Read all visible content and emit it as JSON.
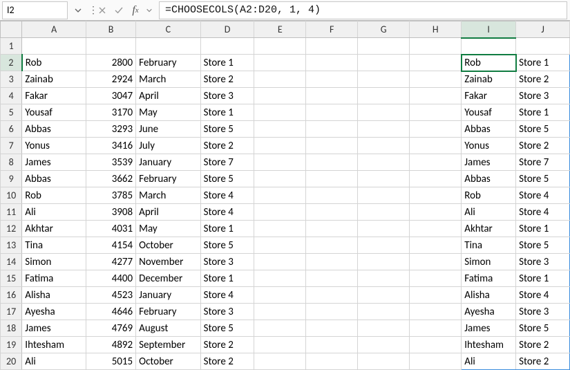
{
  "nameBox": "I2",
  "formula": "=CHOOSECOLS(A2:D20, 1, 4)",
  "columns": [
    "A",
    "B",
    "C",
    "D",
    "E",
    "F",
    "G",
    "H",
    "I",
    "J"
  ],
  "activeCol": "I",
  "activeRow": 2,
  "spill": {
    "startRow": 2,
    "endRow": 20,
    "startCol": "I",
    "endCol": "J"
  },
  "rows": [
    {
      "r": 1,
      "A": "",
      "B": "",
      "C": "",
      "D": "",
      "I": "",
      "J": ""
    },
    {
      "r": 2,
      "A": "Rob",
      "B": 2800,
      "C": "February",
      "D": "Store 1",
      "I": "Rob",
      "J": "Store 1"
    },
    {
      "r": 3,
      "A": "Zainab",
      "B": 2924,
      "C": "March",
      "D": "Store 2",
      "I": "Zainab",
      "J": "Store 2"
    },
    {
      "r": 4,
      "A": "Fakar",
      "B": 3047,
      "C": "April",
      "D": "Store 3",
      "I": "Fakar",
      "J": "Store 3"
    },
    {
      "r": 5,
      "A": "Yousaf",
      "B": 3170,
      "C": "May",
      "D": "Store 1",
      "I": "Yousaf",
      "J": "Store 1"
    },
    {
      "r": 6,
      "A": "Abbas",
      "B": 3293,
      "C": "June",
      "D": "Store 5",
      "I": "Abbas",
      "J": "Store 5"
    },
    {
      "r": 7,
      "A": "Yonus",
      "B": 3416,
      "C": "July",
      "D": "Store 2",
      "I": "Yonus",
      "J": "Store 2"
    },
    {
      "r": 8,
      "A": "James",
      "B": 3539,
      "C": "January",
      "D": "Store 7",
      "I": "James",
      "J": "Store 7"
    },
    {
      "r": 9,
      "A": "Abbas",
      "B": 3662,
      "C": "February",
      "D": "Store 5",
      "I": "Abbas",
      "J": "Store 5"
    },
    {
      "r": 10,
      "A": "Rob",
      "B": 3785,
      "C": "March",
      "D": "Store 4",
      "I": "Rob",
      "J": "Store 4"
    },
    {
      "r": 11,
      "A": "Ali",
      "B": 3908,
      "C": "April",
      "D": "Store 4",
      "I": "Ali",
      "J": "Store 4"
    },
    {
      "r": 12,
      "A": "Akhtar",
      "B": 4031,
      "C": "May",
      "D": "Store 1",
      "I": "Akhtar",
      "J": "Store 1"
    },
    {
      "r": 13,
      "A": "Tina",
      "B": 4154,
      "C": "October",
      "D": "Store 5",
      "I": "Tina",
      "J": "Store 5"
    },
    {
      "r": 14,
      "A": "Simon",
      "B": 4277,
      "C": "November",
      "D": "Store 3",
      "I": "Simon",
      "J": "Store 3"
    },
    {
      "r": 15,
      "A": "Fatima",
      "B": 4400,
      "C": "December",
      "D": "Store 1",
      "I": "Fatima",
      "J": "Store 1"
    },
    {
      "r": 16,
      "A": "Alisha",
      "B": 4523,
      "C": "January",
      "D": "Store 4",
      "I": "Alisha",
      "J": "Store 4"
    },
    {
      "r": 17,
      "A": "Ayesha",
      "B": 4646,
      "C": "February",
      "D": "Store 3",
      "I": "Ayesha",
      "J": "Store 3"
    },
    {
      "r": 18,
      "A": "James",
      "B": 4769,
      "C": "August",
      "D": "Store 5",
      "I": "James",
      "J": "Store 5"
    },
    {
      "r": 19,
      "A": "Ihtesham",
      "B": 4892,
      "C": "September",
      "D": "Store 2",
      "I": "Ihtesham",
      "J": "Store 2"
    },
    {
      "r": 20,
      "A": "Ali",
      "B": 5015,
      "C": "October",
      "D": "Store 2",
      "I": "Ali",
      "J": "Store 2"
    }
  ]
}
